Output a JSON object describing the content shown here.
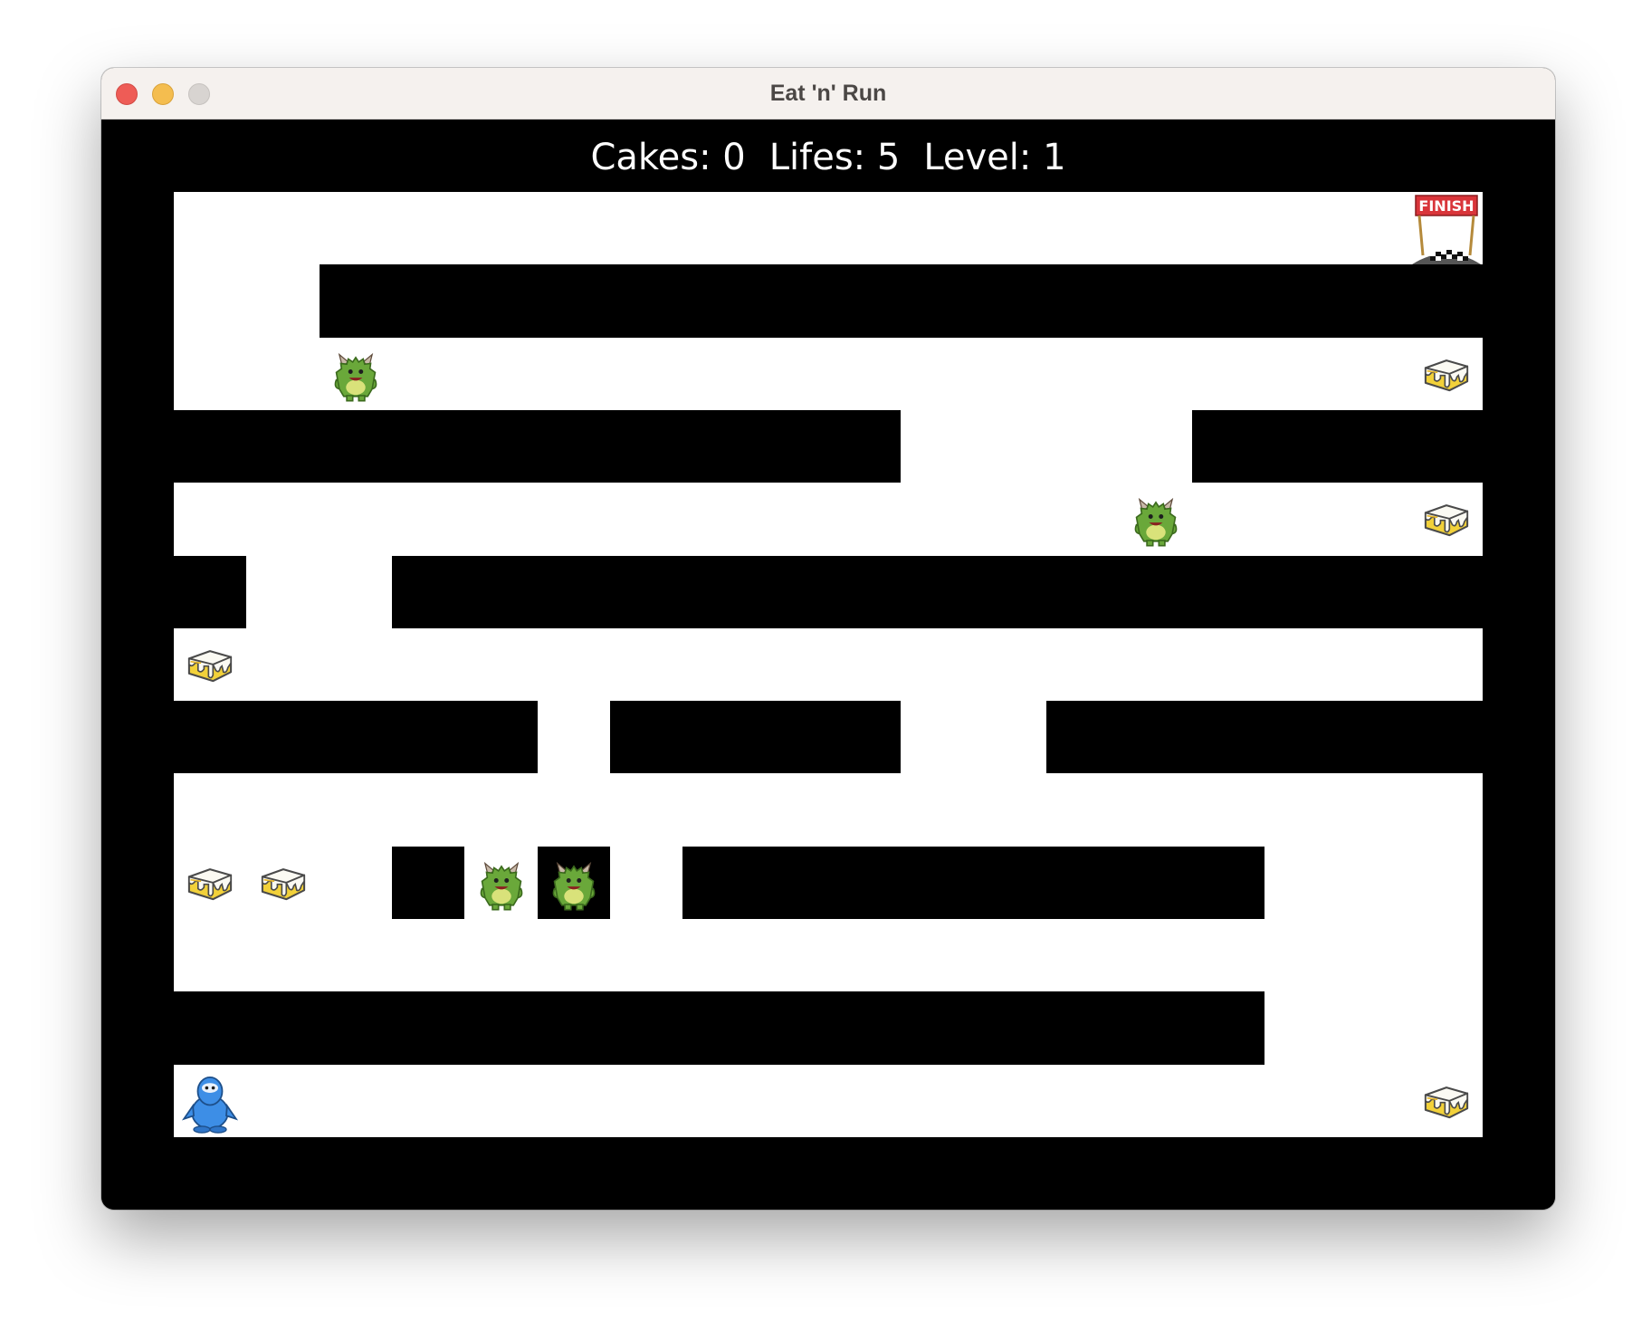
{
  "window": {
    "title": "Eat 'n' Run"
  },
  "hud": {
    "cakes_label": "Cakes: 0",
    "lifes_label": "Lifes: 5",
    "level_label": "Level: 1",
    "cakes": 0,
    "lifes": 5,
    "level": 1
  },
  "colors": {
    "wall": "#000000",
    "floor": "#ffffff",
    "monster": "#6aa83a",
    "cake": "#f2d13a",
    "player": "#3d8ee6",
    "finish_banner": "#d9353a"
  },
  "grid": {
    "rows": [
      "..................",
      "..################",
      "..................",
      "##########....####",
      "..................",
      "#..###############",
      "..................",
      "#####.####..######",
      "..................",
      "...#.#.########...",
      "..................",
      "###############...",
      ".................."
    ]
  },
  "entities": [
    {
      "type": "finish",
      "icon": "finish-flag-icon",
      "row": 0,
      "col": 17,
      "label": "FINISH"
    },
    {
      "type": "monster",
      "icon": "monster-icon",
      "row": 2,
      "col": 2
    },
    {
      "type": "cake",
      "icon": "cake-icon",
      "row": 2,
      "col": 17
    },
    {
      "type": "monster",
      "icon": "monster-icon",
      "row": 4,
      "col": 13
    },
    {
      "type": "cake",
      "icon": "cake-icon",
      "row": 4,
      "col": 17
    },
    {
      "type": "cake",
      "icon": "cake-icon",
      "row": 6,
      "col": 0
    },
    {
      "type": "cake",
      "icon": "cake-icon",
      "row": 9,
      "col": 0
    },
    {
      "type": "cake",
      "icon": "cake-icon",
      "row": 9,
      "col": 1
    },
    {
      "type": "monster",
      "icon": "monster-icon",
      "row": 9,
      "col": 4
    },
    {
      "type": "monster",
      "icon": "monster-icon",
      "row": 9,
      "col": 5
    },
    {
      "type": "player",
      "icon": "penguin-player-icon",
      "row": 12,
      "col": 0
    },
    {
      "type": "cake",
      "icon": "cake-icon",
      "row": 12,
      "col": 17
    }
  ]
}
